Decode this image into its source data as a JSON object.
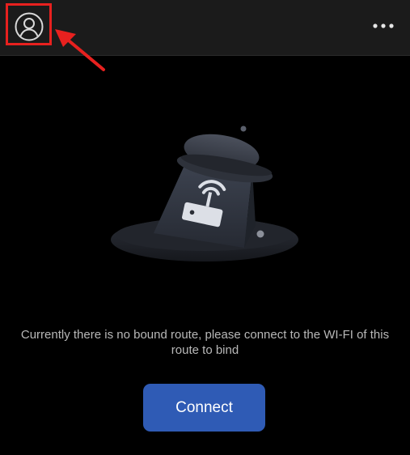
{
  "header": {
    "profile_icon": "user-circle-icon",
    "more_icon": "more-horizontal-icon"
  },
  "annotation": {
    "color": "#e8211f"
  },
  "main": {
    "illustration_icon": "router-hat-illustration",
    "message": "Currently there is no bound route, please connect to the WI-FI of this route to bind",
    "connect_label": "Connect"
  },
  "colors": {
    "background": "#000000",
    "header_background": "#1b1b1b",
    "button": "#2f5bb5",
    "message_text": "#b8b8b8"
  }
}
